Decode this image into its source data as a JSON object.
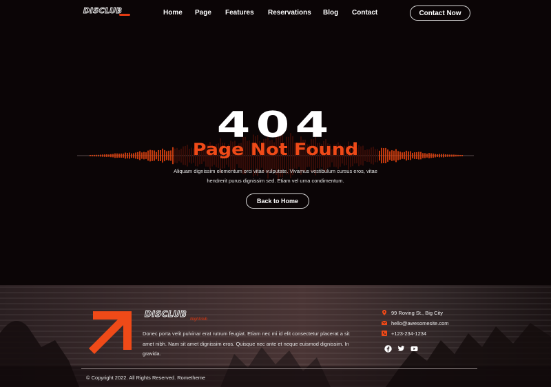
{
  "brand": {
    "logo": "DISCLUB"
  },
  "nav": {
    "items": [
      {
        "label": "Home"
      },
      {
        "label": "Page"
      },
      {
        "label": "Features"
      },
      {
        "label": "Reservations"
      },
      {
        "label": "Blog"
      },
      {
        "label": "Contact"
      }
    ],
    "cta": "Contact Now"
  },
  "hero": {
    "code": "404",
    "title": "Page Not Found",
    "description": "Aliquam dignissim elementum orci vitae vulputate. Vivamus vestibulum cursus eros, vitae hendrerit purus dignissim sed. Etiam vel urna condimentum.",
    "button": "Back to Home"
  },
  "footer": {
    "logo": "DISCLUB",
    "logo_sub": "Nightclub",
    "description": "Donec porta velit pulvinar erat rutrum feugiat. Etiam nec mi id elit consectetur placerat a sit amet nibh. Nam sit amet dignissim eros. Quisque nec ante et neque euismod dignissim. In gravida.",
    "address": "99 Roving St., Big City",
    "email": "hello@awesomesite.com",
    "phone": "+123-234-1234",
    "social": [
      "facebook-icon",
      "twitter-icon",
      "youtube-icon"
    ],
    "copyright": "© Copyright 2022. All Rights Reserved. Rometheme"
  },
  "colors": {
    "accent": "#ef4a18",
    "background": "#0b0506"
  }
}
